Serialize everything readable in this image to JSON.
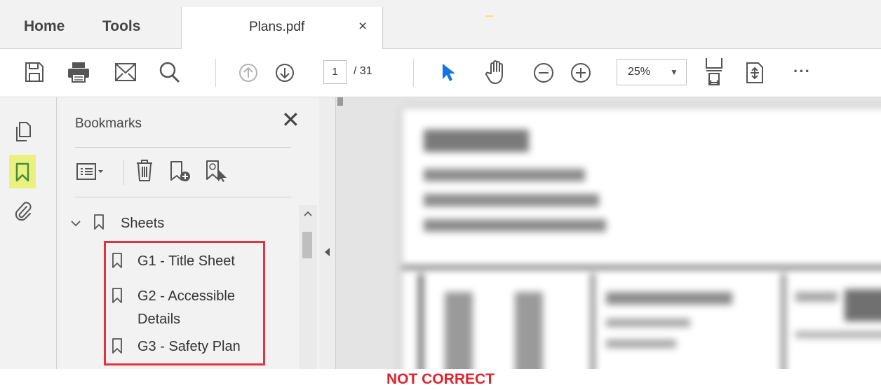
{
  "menubar": {
    "home_label": "Home",
    "tools_label": "Tools",
    "doc_tab_label": "Plans.pdf",
    "doc_tab_close": "×"
  },
  "toolbar": {
    "icons": [
      "save-icon",
      "print-icon",
      "email-icon",
      "search-icon",
      "prev-page-icon",
      "next-page-icon",
      "select-pointer-icon",
      "hand-tool-icon",
      "zoom-out-icon",
      "zoom-in-icon",
      "fit-page-icon",
      "scroll-mode-icon",
      "more-options-icon"
    ],
    "page_current": "1",
    "page_total": "/ 31",
    "zoom_value": "25%",
    "more_label": "···",
    "accent_color": "#1473e6"
  },
  "left_rail": {
    "icons": [
      "page-thumbnails-icon",
      "bookmarks-icon",
      "attachments-icon"
    ],
    "active_highlight_color": "#e9f27d"
  },
  "bookmarks_panel": {
    "title": "Bookmarks",
    "close_label": "✕",
    "toolbar_icons": [
      "options-icon",
      "delete-bookmark-icon",
      "new-bookmark-icon",
      "new-bookmark-from-structure-icon"
    ],
    "root": {
      "label": "Sheets",
      "expanded": true
    },
    "items": [
      {
        "lines": [
          "G1 - Title Sheet"
        ]
      },
      {
        "lines": [
          "G2 - Accessible",
          "Details"
        ]
      },
      {
        "lines": [
          "G3 - Safety Plan"
        ]
      }
    ],
    "highlight_color": "#e0353c"
  },
  "caption": {
    "text": "NOT CORRECT",
    "color": "#e0232c"
  }
}
